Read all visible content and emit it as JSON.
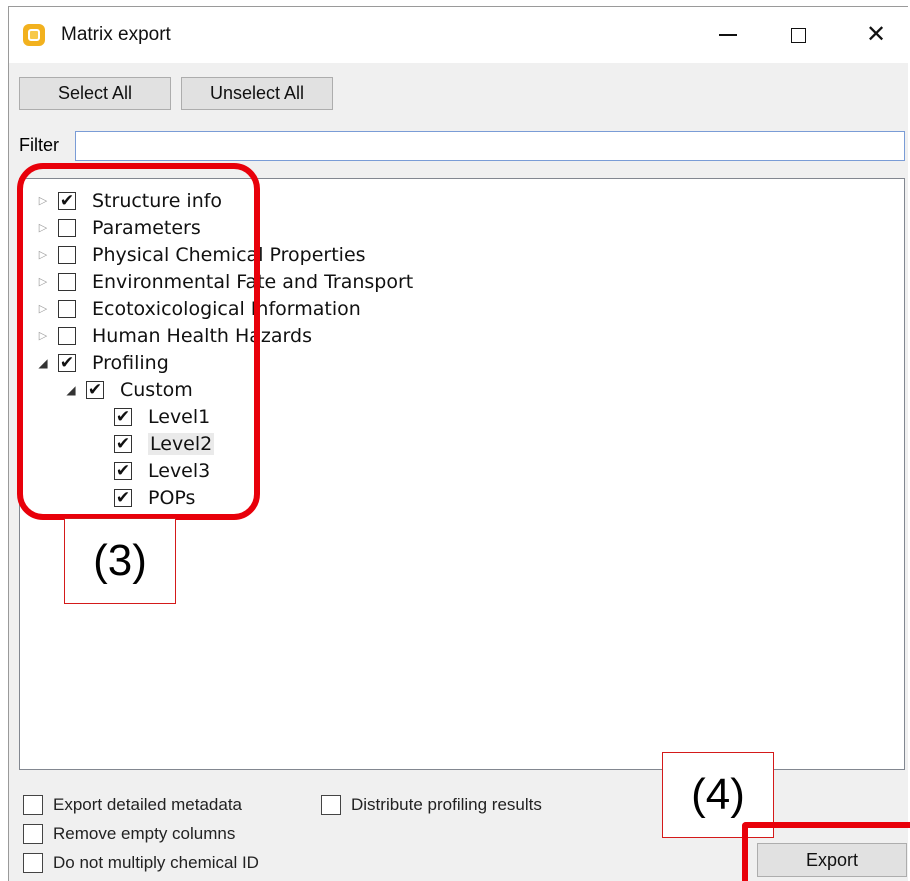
{
  "window": {
    "title": "Matrix export"
  },
  "titlebar": {
    "minimize": "minimize",
    "maximize": "maximize",
    "close": "✕"
  },
  "toolbar": {
    "select_all": "Select All",
    "unselect_all": "Unselect All"
  },
  "filter": {
    "label": "Filter",
    "value": ""
  },
  "tree": {
    "items": [
      {
        "label": "Structure info",
        "checked": "✔"
      },
      {
        "label": "Parameters",
        "checked": ""
      },
      {
        "label": "Physical Chemical Properties",
        "checked": ""
      },
      {
        "label": "Environmental Fate and Transport",
        "checked": ""
      },
      {
        "label": "Ecotoxicological Information",
        "checked": ""
      },
      {
        "label": "Human Health Hazards",
        "checked": ""
      },
      {
        "label": "Profiling",
        "checked": "✔"
      },
      {
        "label": "Custom",
        "checked": "✔"
      },
      {
        "label": "Level1",
        "checked": "✔"
      },
      {
        "label": "Level2",
        "checked": "✔"
      },
      {
        "label": "Level3",
        "checked": "✔"
      },
      {
        "label": "POPs",
        "checked": "✔"
      }
    ]
  },
  "options": {
    "export_detailed_metadata": "Export detailed metadata",
    "distribute_profiling_results": "Distribute profiling results",
    "remove_empty_columns": "Remove empty columns",
    "do_not_multiply_chemical_id": "Do not multiply chemical ID"
  },
  "footer": {
    "export_label": "Export"
  },
  "annotations": {
    "step3": "(3)",
    "step4": "(4)",
    "color": "#e8000a"
  }
}
